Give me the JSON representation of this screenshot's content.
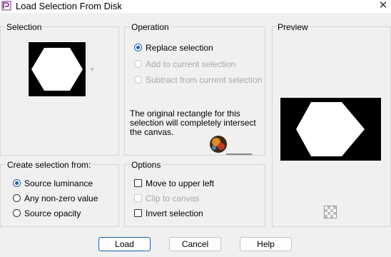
{
  "window": {
    "title": "Load Selection From Disk",
    "close_glyph": "✕"
  },
  "selection": {
    "label": "Selection",
    "dropdown_glyph": "▾"
  },
  "operation": {
    "label": "Operation",
    "options": [
      {
        "label": "Replace selection",
        "selected": true,
        "enabled": true
      },
      {
        "label": "Add to current selection",
        "selected": false,
        "enabled": false
      },
      {
        "label": "Subtract from current selection",
        "selected": false,
        "enabled": false
      }
    ],
    "description": "The original rectangle for this\nselection will completely intersect\nthe canvas."
  },
  "preview": {
    "label": "Preview"
  },
  "create_from": {
    "label": "Create selection from:",
    "options": [
      {
        "label": "Source luminance",
        "selected": true
      },
      {
        "label": "Any non-zero value",
        "selected": false
      },
      {
        "label": "Source opacity",
        "selected": false
      }
    ]
  },
  "options": {
    "label": "Options",
    "items": [
      {
        "label": "Move to upper left",
        "checked": false,
        "enabled": true
      },
      {
        "label": "Clip to canvas",
        "checked": false,
        "enabled": false
      },
      {
        "label": "Invert selection",
        "checked": false,
        "enabled": true
      }
    ]
  },
  "buttons": {
    "load": "Load",
    "cancel": "Cancel",
    "help": "Help"
  },
  "icons": {
    "app": "paint-shop-icon",
    "preview_toggle": "checkerboard-icon",
    "watermark": "watermark-logo"
  },
  "colors": {
    "accent": "#1b5fb8",
    "disabled_text": "#a9a9a9",
    "group_border": "#d5d5d5"
  }
}
